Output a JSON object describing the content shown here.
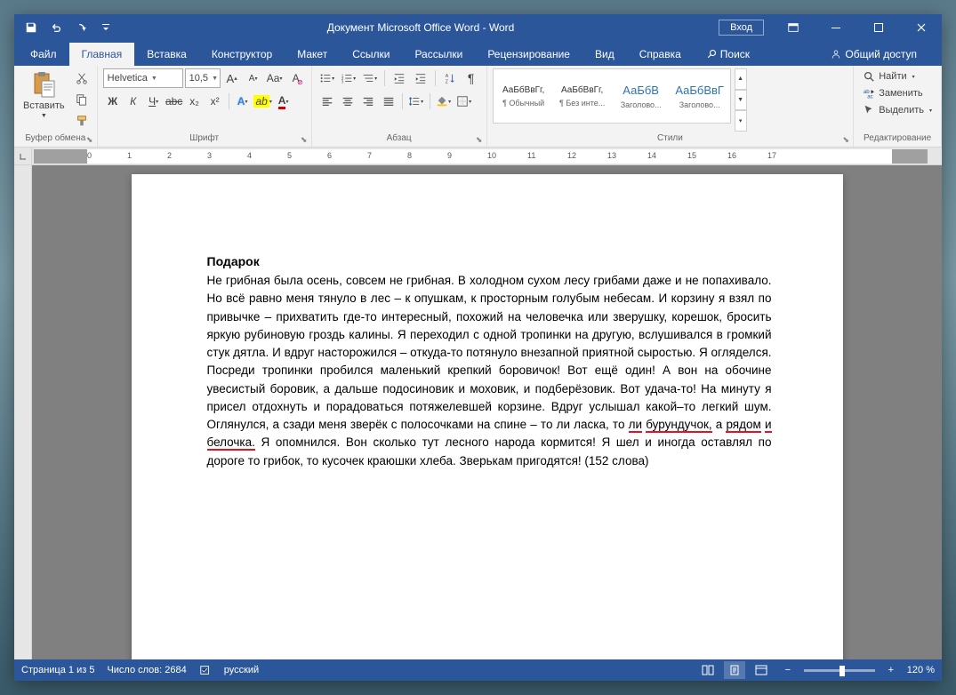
{
  "titlebar": {
    "title": "Документ Microsoft Office Word  -  Word",
    "login": "Вход"
  },
  "tabs": {
    "file": "Файл",
    "home": "Главная",
    "insert": "Вставка",
    "design": "Конструктор",
    "layout": "Макет",
    "references": "Ссылки",
    "mailings": "Рассылки",
    "review": "Рецензирование",
    "view": "Вид",
    "help": "Справка",
    "search": "Поиск",
    "share": "Общий доступ"
  },
  "ribbon": {
    "clipboard": {
      "label": "Буфер обмена",
      "paste": "Вставить"
    },
    "font": {
      "label": "Шрифт",
      "name": "Helvetica",
      "size": "10,5",
      "bold": "Ж",
      "italic": "К",
      "underline": "Ч",
      "strike": "abc",
      "sub": "x₂",
      "sup": "x²"
    },
    "paragraph": {
      "label": "Абзац"
    },
    "styles": {
      "label": "Стили",
      "items": [
        {
          "preview": "АаБбВвГг,",
          "name": "¶ Обычный",
          "blue": false
        },
        {
          "preview": "АаБбВвГг,",
          "name": "¶ Без инте...",
          "blue": false
        },
        {
          "preview": "АаБбВ",
          "name": "Заголово...",
          "blue": true
        },
        {
          "preview": "АаБбВвГ",
          "name": "Заголово...",
          "blue": true
        }
      ]
    },
    "editing": {
      "label": "Редактирование",
      "find": "Найти",
      "replace": "Заменить",
      "select": "Выделить"
    }
  },
  "document": {
    "title": "Подарок",
    "body": "Не грибная была осень, совсем не грибная. В холодном сухом лесу грибами даже и не попахивало. Но всё равно меня тянуло в лес – к опушкам, к просторным голубым небесам. И корзину я взял по привычке – прихватить где-то интересный, похожий на человечка или зверушку, корешок, бросить яркую рубиновую гроздь калины. Я переходил с одной тропинки на другую, вслушивался в громкий стук дятла. И вдруг насторожился – откуда-то потянуло внезапной приятной сыростью. Я огляделся. Посреди тропинки пробился маленький крепкий боровичок! Вот ещё один! А вон на обочине увесистый боровик, а дальше подосиновик и моховик, и подберёзовик. Вот удача-то! На минуту я присел отдохнуть и порадоваться потяжелевшей корзине. Вдруг услышал какой–то легкий шум. Оглянулся, а сзади меня зверёк с полосочками на спине – то ли ласка, ",
    "err_line": {
      "w1": "то",
      "e1": "ли",
      "e2": "бурундучок,",
      "w2": "а",
      "e3": "рядом",
      "e4": "и",
      "e5": "белочка."
    },
    "body2": "Я опомнился. Вон сколько тут лесного народа кормится! Я шел и иногда оставлял по дороге то грибок, то кусочек краюшки хлеба. Зверькам пригодятся! (152 слова)"
  },
  "status": {
    "page": "Страница 1 из 5",
    "words": "Число слов: 2684",
    "lang": "русский",
    "zoom": "120 %"
  }
}
